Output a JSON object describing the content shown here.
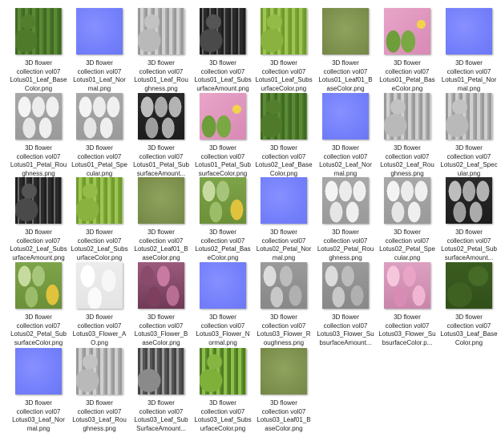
{
  "files": [
    {
      "label": [
        "3D flower",
        "collection vol07",
        "Lotus01_Leaf_Base",
        "Color.png"
      ],
      "texture": "leafcolor"
    },
    {
      "label": [
        "3D flower",
        "collection vol07",
        "Lotus01_Leaf_Nor",
        "mal.png"
      ],
      "texture": "normal"
    },
    {
      "label": [
        "3D flower",
        "collection vol07",
        "Lotus01_Leaf_Rou",
        "ghness.png"
      ],
      "texture": "gray"
    },
    {
      "label": [
        "3D flower",
        "collection vol07",
        "Lotus01_Leaf_Subs",
        "urfaceAmount.png"
      ],
      "texture": "dark"
    },
    {
      "label": [
        "3D flower",
        "collection vol07",
        "Lotus01_Leaf_Subs",
        "urfaceColor.png"
      ],
      "texture": "lime"
    },
    {
      "label": [
        "3D flower",
        "collection vol07",
        "Lotus01_Leaf01_B",
        "aseColor.png"
      ],
      "texture": "olive"
    },
    {
      "label": [
        "3D flower",
        "collection vol07",
        "Lotus01_Petal_Bas",
        "eColor.png"
      ],
      "texture": "petalcolor"
    },
    {
      "label": [
        "3D flower",
        "collection vol07",
        "Lotus01_Petal_Nor",
        "mal.png"
      ],
      "texture": "normal"
    },
    {
      "label": [
        "3D flower",
        "collection vol07",
        "Lotus01_Petal_Rou",
        "ghness.png"
      ],
      "texture": "petalgray"
    },
    {
      "label": [
        "3D flower",
        "collection vol07",
        "Lotus01_Petal_Spe",
        "cular.png"
      ],
      "texture": "petalgray"
    },
    {
      "label": [
        "3D flower",
        "collection vol07",
        "Lotus01_Petal_Sub",
        "surfaceAmount..."
      ],
      "texture": "petaldark"
    },
    {
      "label": [
        "3D flower",
        "collection vol07",
        "Lotus01_Petal_Sub",
        "surfaceColor.png"
      ],
      "texture": "petalcolor"
    },
    {
      "label": [
        "3D flower",
        "collection vol07",
        "Lotus02_Leaf_Base",
        "Color.png"
      ],
      "texture": "leafcolor"
    },
    {
      "label": [
        "3D flower",
        "collection vol07",
        "Lotus02_Leaf_Nor",
        "mal.png"
      ],
      "texture": "normal"
    },
    {
      "label": [
        "3D flower",
        "collection vol07",
        "Lotus02_Leaf_Rou",
        "ghness.png"
      ],
      "texture": "gray"
    },
    {
      "label": [
        "3D flower",
        "collection vol07",
        "Lotus02_Leaf_Spec",
        "ular.png"
      ],
      "texture": "gray"
    },
    {
      "label": [
        "3D flower",
        "collection vol07",
        "Lotus02_Leaf_Subs",
        "urfaceAmount.png"
      ],
      "texture": "dark"
    },
    {
      "label": [
        "3D flower",
        "collection vol07",
        "Lotus02_Leaf_Subs",
        "urfaceColor.png"
      ],
      "texture": "lime"
    },
    {
      "label": [
        "3D flower",
        "collection vol07",
        "Lotus02_Leaf01_B",
        "aseColor.png"
      ],
      "texture": "olive"
    },
    {
      "label": [
        "3D flower",
        "collection vol07",
        "Lotus02_Petal_Bas",
        "eColor.png"
      ],
      "texture": "petalgreen"
    },
    {
      "label": [
        "3D flower",
        "collection vol07",
        "Lotus02_Petal_Nor",
        "mal.png"
      ],
      "texture": "normal"
    },
    {
      "label": [
        "3D flower",
        "collection vol07",
        "Lotus02_Petal_Rou",
        "ghness.png"
      ],
      "texture": "petalgray"
    },
    {
      "label": [
        "3D flower",
        "collection vol07",
        "Lotus02_Petal_Spe",
        "cular.png"
      ],
      "texture": "petalgray"
    },
    {
      "label": [
        "3D flower",
        "collection vol07",
        "Lotus02_Petal_Sub",
        "surfaceAmount..."
      ],
      "texture": "petaldark"
    },
    {
      "label": [
        "3D flower",
        "collection vol07",
        "Lotus02_Petal_Sub",
        "surfaceColor.png"
      ],
      "texture": "petalgreen"
    },
    {
      "label": [
        "3D flower",
        "collection vol07",
        "Lotus03_Flower_A",
        "O.png"
      ],
      "texture": "white"
    },
    {
      "label": [
        "3D flower",
        "collection vol07",
        "Lotus03_Flower_B",
        "aseColor.png"
      ],
      "texture": "magenta"
    },
    {
      "label": [
        "3D flower",
        "collection vol07",
        "Lotus03_Flower_N",
        "ormal.png"
      ],
      "texture": "normal"
    },
    {
      "label": [
        "3D flower",
        "collection vol07",
        "Lotus03_Flower_R",
        "oughness.png"
      ],
      "texture": "flowergray"
    },
    {
      "label": [
        "3D flower",
        "collection vol07",
        "Lotus03_Flower_Su",
        "bsurfaceAmount..."
      ],
      "texture": "flowergray"
    },
    {
      "label": [
        "3D flower",
        "collection vol07",
        "Lotus03_Flower_Su",
        "bsurfaceColor.p..."
      ],
      "texture": "flowerpink"
    },
    {
      "label": [
        "3D flower",
        "collection vol07",
        "Lotus03_Leaf_Base",
        "Color.png"
      ],
      "texture": "darkgreen"
    },
    {
      "label": [
        "3D flower",
        "collection vol07",
        "Lotus03_Leaf_Nor",
        "mal.png"
      ],
      "texture": "normal"
    },
    {
      "label": [
        "3D flower",
        "collection vol07",
        "Lotus03_Leaf_Rou",
        "ghness.png"
      ],
      "texture": "gray"
    },
    {
      "label": [
        "3D flower",
        "collection vol07",
        "Lotus03_Leaf_Sub",
        "SurfaceAmount..."
      ],
      "texture": "subgray"
    },
    {
      "label": [
        "3D flower",
        "collection vol07",
        "Lotus03_Leaf_Subs",
        "urfaceColor.png"
      ],
      "texture": "leafsubs3"
    },
    {
      "label": [
        "3D flower",
        "collection vol07",
        "Lotus03_Leaf01_B",
        "aseColor.png"
      ],
      "texture": "olive"
    }
  ]
}
